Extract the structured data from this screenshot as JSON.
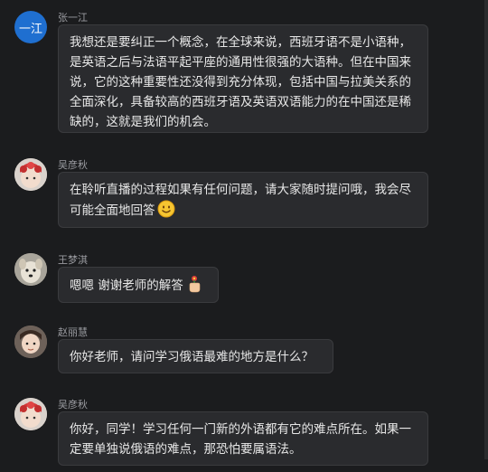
{
  "messages": [
    {
      "sender": "张一江",
      "avatar_text": "一江",
      "text": "我想还是要纠正一个概念，在全球来说，西班牙语不是小语种，是英语之后与法语平起平座的通用性很强的大语种。但在中国来说，它的这种重要性还没得到充分体现，包括中国与拉美关系的全面深化，具备较高的西班牙语及英语双语能力的在中国还是稀缺的，这就是我们的机会。"
    },
    {
      "sender": "吴彦秋",
      "text": "在聆听直播的过程如果有任何问题，请大家随时提问哦，我会尽可能全面地回答",
      "emoji": "smile-emoji"
    },
    {
      "sender": "王梦淇",
      "text": "嗯嗯 谢谢老师的解答",
      "emoji": "flower-hand-emoji"
    },
    {
      "sender": "赵丽慧",
      "text": "你好老师，请问学习俄语最难的地方是什么？"
    },
    {
      "sender": "吴彦秋",
      "text": "你好，同学！学习任何一门新的外语都有它的难点所在。如果一定要单独说俄语的难点，那恐怕要属语法。"
    }
  ]
}
